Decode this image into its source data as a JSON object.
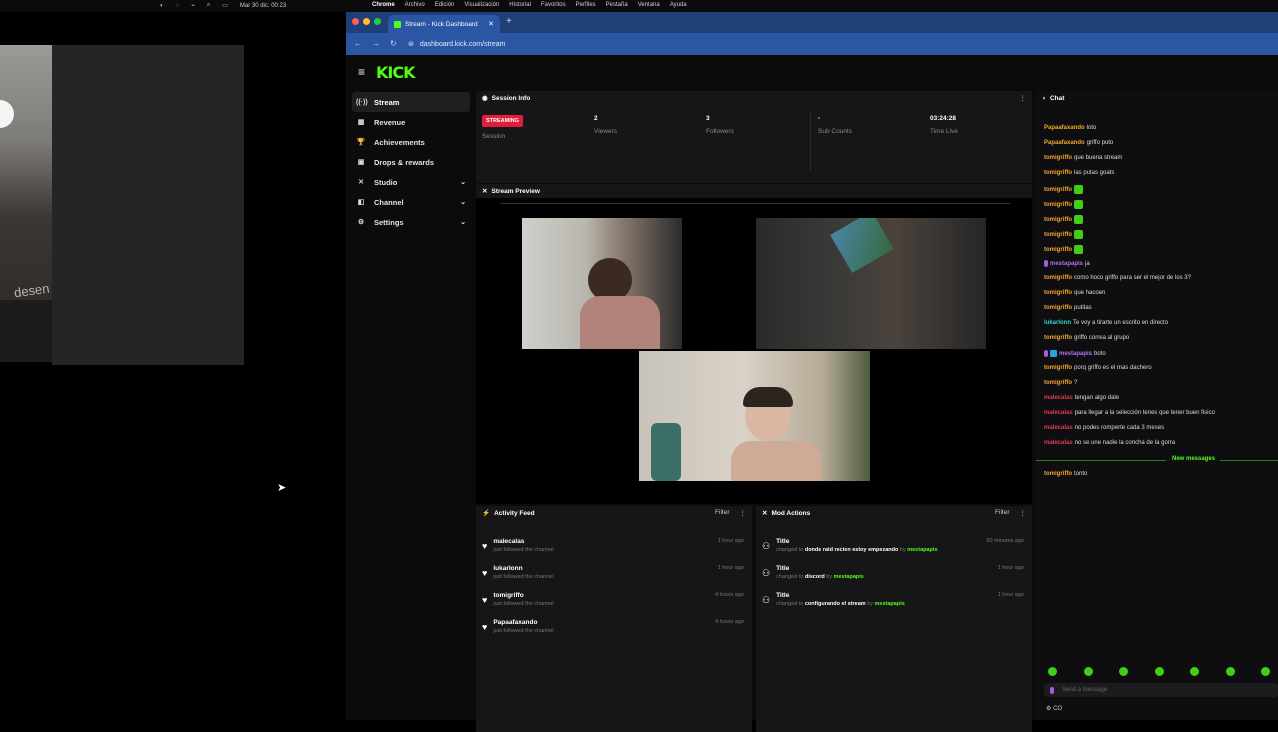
{
  "menubar": {
    "clock": "Mar 30 dic.  00:23",
    "menus": [
      "Chrome",
      "Archivo",
      "Edición",
      "Visualización",
      "Historial",
      "Favoritos",
      "Perfiles",
      "Pestaña",
      "Ventana",
      "Ayuda"
    ]
  },
  "webcam_text": "desen",
  "browser": {
    "tab_title": "Stream - Kick Dashboard",
    "url": "dashboard.kick.com/stream"
  },
  "kick": {
    "logo": "KICK",
    "sidebar": [
      {
        "label": "Stream",
        "icon": "stream-icon",
        "glyph": "((·))",
        "active": true,
        "chevron": ""
      },
      {
        "label": "Revenue",
        "icon": "revenue-icon",
        "glyph": "▦",
        "active": false,
        "chevron": ""
      },
      {
        "label": "Achievements",
        "icon": "trophy-icon",
        "glyph": "🏆",
        "active": false,
        "chevron": ""
      },
      {
        "label": "Drops & rewards",
        "icon": "gift-icon",
        "glyph": "▣",
        "active": false,
        "chevron": ""
      },
      {
        "label": "Studio",
        "icon": "studio-icon",
        "glyph": "✕",
        "active": false,
        "chevron": "⌄"
      },
      {
        "label": "Channel",
        "icon": "channel-icon",
        "glyph": "◧",
        "active": false,
        "chevron": "⌄"
      },
      {
        "label": "Settings",
        "icon": "settings-icon",
        "glyph": "⚙",
        "active": false,
        "chevron": "⌄"
      }
    ],
    "session": {
      "title": "Session Info",
      "badge": "STREAMING",
      "session_label": "Session",
      "viewers_value": "2",
      "viewers_label": "Viewers",
      "followers_value": "3",
      "followers_label": "Followers",
      "subs_value": "-",
      "subs_label": "Sub Counts",
      "time_value": "03:24:28",
      "time_label": "Time Live"
    },
    "preview": {
      "title": "Stream Preview"
    },
    "activity": {
      "title": "Activity Feed",
      "filter": "Filter",
      "items": [
        {
          "name": "malecalas",
          "sub": "just followed the channel",
          "time": "1 hour ago"
        },
        {
          "name": "lukarlonn",
          "sub": "just followed the channel",
          "time": "1 hour ago"
        },
        {
          "name": "tomigriffo",
          "sub": "just followed the channel",
          "time": "4 hours ago"
        },
        {
          "name": "Papaafaxando",
          "sub": "just followed the channel",
          "time": "4 hours ago"
        }
      ]
    },
    "mod_actions": {
      "title": "Mod Actions",
      "filter": "Filter",
      "items": [
        {
          "name": "Title",
          "pre": "changed to",
          "value": "donde raid recien estoy empezando",
          "by": "by",
          "mod": "mestapapis",
          "time": "50 minutes ago"
        },
        {
          "name": "Title",
          "pre": "changed to",
          "value": "discord",
          "by": "by",
          "mod": "mestapapis",
          "time": "1 hour ago"
        },
        {
          "name": "Title",
          "pre": "changed to",
          "value": "configurando el stream",
          "by": "by",
          "mod": "mestapapis",
          "time": "1 hour ago"
        }
      ]
    },
    "chat": {
      "title": "Chat",
      "new_messages": "New messages",
      "input_placeholder": "Send a message",
      "footer": "CO",
      "lines": [
        {
          "user": "Papaafaxando",
          "color": "#f0a830",
          "text": "loto",
          "emote": false,
          "badges": ""
        },
        {
          "user": "Papaafaxando",
          "color": "#f0a830",
          "text": "griffo puto",
          "emote": false,
          "badges": ""
        },
        {
          "user": "tomigriffo",
          "color": "#f0a830",
          "text": "que buena stream",
          "emote": false,
          "badges": ""
        },
        {
          "user": "tomigriffo",
          "color": "#f0a830",
          "text": "las putas goats",
          "emote": false,
          "badges": ""
        },
        {
          "user": "tomigriffo",
          "color": "#f0a830",
          "text": "",
          "emote": true,
          "badges": ""
        },
        {
          "user": "tomigriffo",
          "color": "#f0a830",
          "text": "",
          "emote": true,
          "badges": ""
        },
        {
          "user": "tomigriffo",
          "color": "#f0a830",
          "text": "",
          "emote": true,
          "badges": ""
        },
        {
          "user": "tomigriffo",
          "color": "#f0a830",
          "text": "",
          "emote": true,
          "badges": ""
        },
        {
          "user": "tomigriffo",
          "color": "#f0a830",
          "text": "",
          "emote": true,
          "badges": ""
        },
        {
          "user": "mestapapis",
          "color": "#b46ef0",
          "text": "ja",
          "emote": false,
          "badges": "mic"
        },
        {
          "user": "tomigriffo",
          "color": "#f0a830",
          "text": "como hoco griffo para ser el mejor de los 3?",
          "emote": false,
          "badges": ""
        },
        {
          "user": "tomigriffo",
          "color": "#f0a830",
          "text": "que hacoen",
          "emote": false,
          "badges": ""
        },
        {
          "user": "tomigriffo",
          "color": "#f0a830",
          "text": "putitas",
          "emote": false,
          "badges": ""
        },
        {
          "user": "lukarlonn",
          "color": "#3ad3c8",
          "text": "Te voy a tirarte un escrito en directo",
          "emote": false,
          "badges": ""
        },
        {
          "user": "tomigriffo",
          "color": "#f0a830",
          "text": "griffo correa al grupo",
          "emote": false,
          "badges": ""
        },
        {
          "user": "mestapapis",
          "color": "#b46ef0",
          "text": "boto",
          "emote": false,
          "badges": "mic-mod"
        },
        {
          "user": "tomigriffo",
          "color": "#f0a830",
          "text": "porq griffo es el mas dachero",
          "emote": false,
          "badges": ""
        },
        {
          "user": "tomigriffo",
          "color": "#f0a830",
          "text": "?",
          "emote": false,
          "badges": ""
        },
        {
          "user": "malecalas",
          "color": "#e03a4e",
          "text": "tengan algo dale",
          "emote": false,
          "badges": ""
        },
        {
          "user": "malecalas",
          "color": "#e03a4e",
          "text": "para llegar a la selección tenes que tener buen fisico",
          "emote": false,
          "badges": ""
        },
        {
          "user": "malecalas",
          "color": "#e03a4e",
          "text": "no podes romperte cada 3 meses",
          "emote": false,
          "badges": ""
        },
        {
          "user": "malecalas",
          "color": "#e03a4e",
          "text": "no se une nadie la concha de la gorra",
          "emote": false,
          "badges": ""
        },
        {
          "user": "tomigriffo",
          "color": "#f0a830",
          "text": "tonto",
          "emote": false,
          "badges": ""
        }
      ]
    }
  }
}
